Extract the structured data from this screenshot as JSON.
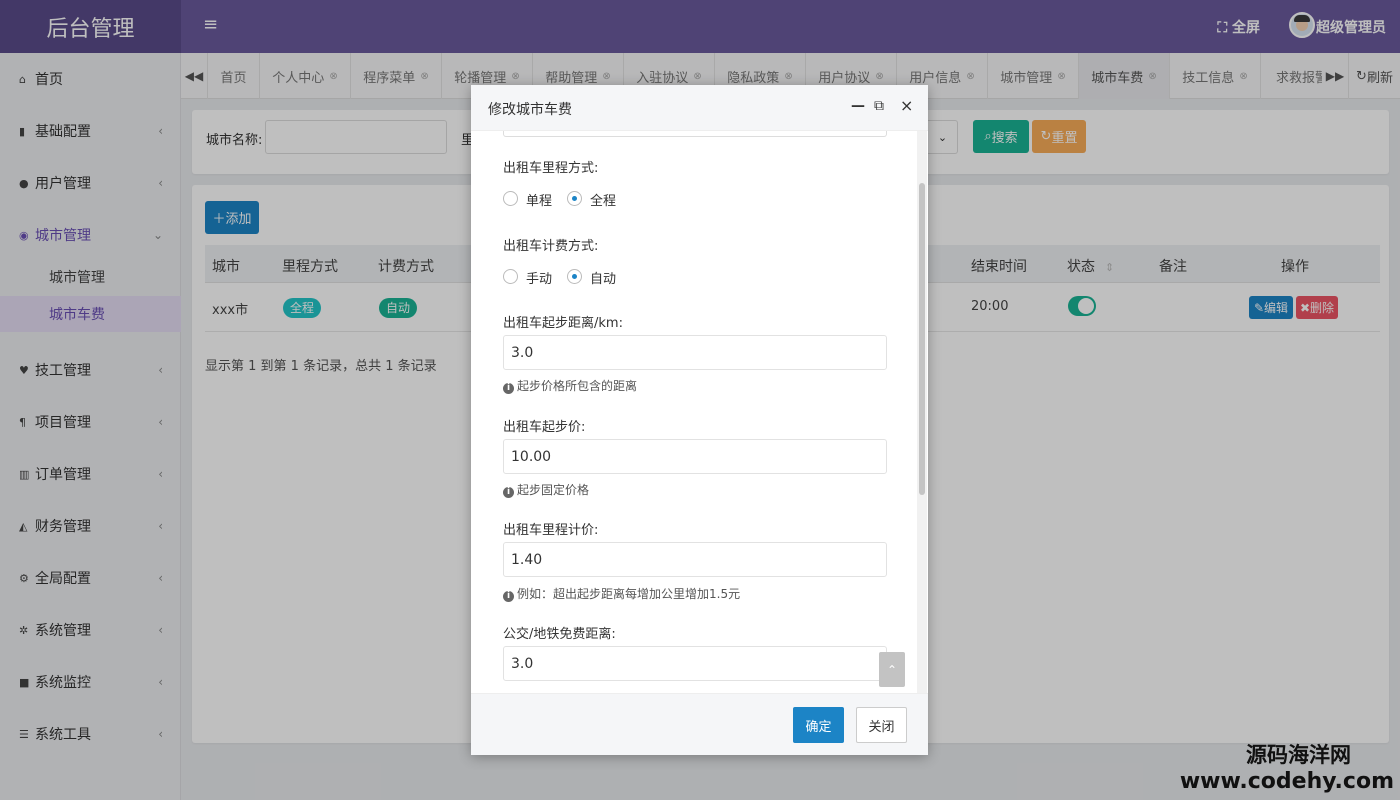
{
  "header": {
    "brand": "后台管理",
    "menu_icon": "≡",
    "fullscreen": "全屏",
    "username": "超级管理员"
  },
  "sidebar": {
    "items": [
      {
        "icon": "home-icon",
        "label": "首页"
      },
      {
        "icon": "bookmark-icon",
        "label": "基础配置"
      },
      {
        "icon": "user-icon",
        "label": "用户管理"
      },
      {
        "icon": "globe-icon",
        "label": "城市管理"
      },
      {
        "icon": "heart-icon",
        "label": "技工管理"
      },
      {
        "icon": "paragraph-icon",
        "label": "项目管理"
      },
      {
        "icon": "bar-chart-icon",
        "label": "订单管理"
      },
      {
        "icon": "area-chart-icon",
        "label": "财务管理"
      },
      {
        "icon": "cogs-icon",
        "label": "全局配置"
      },
      {
        "icon": "gear-icon",
        "label": "系统管理"
      },
      {
        "icon": "video-icon",
        "label": "系统监控"
      },
      {
        "icon": "list-icon",
        "label": "系统工具"
      }
    ],
    "subitems": [
      "城市管理",
      "城市车费"
    ]
  },
  "tabs": {
    "items": [
      "首页",
      "个人中心",
      "程序菜单",
      "轮播管理",
      "帮助管理",
      "入驻协议",
      "隐私政策",
      "用户协议",
      "用户信息",
      "城市管理",
      "城市车费",
      "技工信息",
      "求救报警"
    ],
    "active": "城市车费",
    "refresh": "刷新"
  },
  "search": {
    "city_label": "城市名称:",
    "city_value": "",
    "second_label": "里",
    "search_btn": "搜索",
    "reset_btn": "重置"
  },
  "table": {
    "add_btn": "添加",
    "columns": [
      "城市",
      "里程方式",
      "计费方式",
      "结束时间",
      "状态",
      "备注",
      "操作"
    ],
    "rows": [
      {
        "city": "xxx市",
        "mileage": "全程",
        "billing": "自动",
        "end_time": "20:00",
        "status": true,
        "remark": "",
        "edit": "编辑",
        "delete": "删除"
      }
    ],
    "pager": "显示第 1 到第 1 条记录，总共 1 条记录"
  },
  "modal": {
    "title": "修改城市车费",
    "fields": {
      "mileage_mode_label": "出租车里程方式:",
      "mileage_options": [
        "单程",
        "全程"
      ],
      "mileage_selected": "全程",
      "billing_mode_label": "出租车计费方式:",
      "billing_options": [
        "手动",
        "自动"
      ],
      "billing_selected": "自动",
      "start_distance_label": "出租车起步距离/km:",
      "start_distance": "3.0",
      "start_distance_help": "起步价格所包含的距离",
      "start_price_label": "出租车起步价:",
      "start_price": "10.00",
      "start_price_help": "起步固定价格",
      "per_km_label": "出租车里程计价:",
      "per_km": "1.40",
      "per_km_help": "例如：超出起步距离每增加公里增加1.5元",
      "transit_free_label": "公交/地铁免费距离:",
      "transit_free": "3.0"
    },
    "ok": "确定",
    "close": "关闭"
  },
  "watermark": {
    "line1": "源码海洋网",
    "line2": "www.codehy.com"
  },
  "colors": {
    "header": "#6a5a9c",
    "brand_bg": "#5a4b8a",
    "primary": "#1c84c6",
    "teal": "#1ab394",
    "warning": "#f8ac59",
    "danger": "#ed5565",
    "active_nav": "#6a4fb4"
  }
}
